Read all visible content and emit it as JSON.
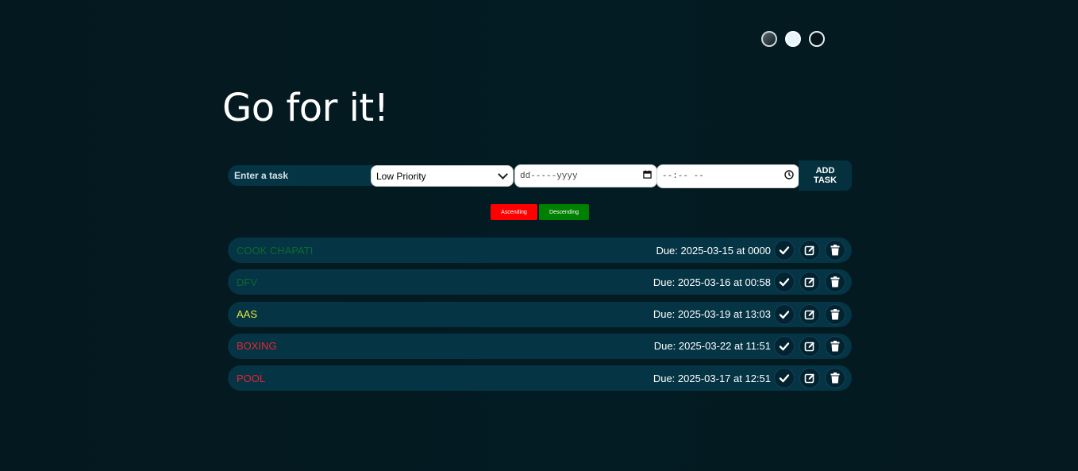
{
  "themes": [
    "dark",
    "light",
    "night"
  ],
  "title": "Go for it!",
  "form": {
    "task_placeholder": "Enter a task",
    "priority_selected": "Low Priority",
    "date_placeholder": "dd-----yyyy",
    "time_placeholder": "--:-- --",
    "add_label_line1": "ADD",
    "add_label_line2": "TASK"
  },
  "sort": {
    "ascending": "Ascending",
    "descending": "Descending",
    "ascending_color": "#ff0000",
    "descending_color": "#008000"
  },
  "tasks": [
    {
      "name": "COOK CHAPATI",
      "due": "Due: 2025-03-15 at 0000",
      "color": "#0b6b2a"
    },
    {
      "name": "DFV",
      "due": "Due: 2025-03-16 at 00:58",
      "color": "#0b6b2a"
    },
    {
      "name": "AAS",
      "due": "Due: 2025-03-19 at 13:03",
      "color": "#e6e63a"
    },
    {
      "name": "BOXING",
      "due": "Due: 2025-03-22 at 11:51",
      "color": "#e8252f"
    },
    {
      "name": "POOL",
      "due": "Due: 2025-03-17 at 12:51",
      "color": "#e8252f"
    }
  ],
  "icons": {
    "complete": "check-icon",
    "edit": "edit-icon",
    "delete": "trash-icon",
    "calendar": "calendar-icon",
    "clock": "clock-icon"
  }
}
